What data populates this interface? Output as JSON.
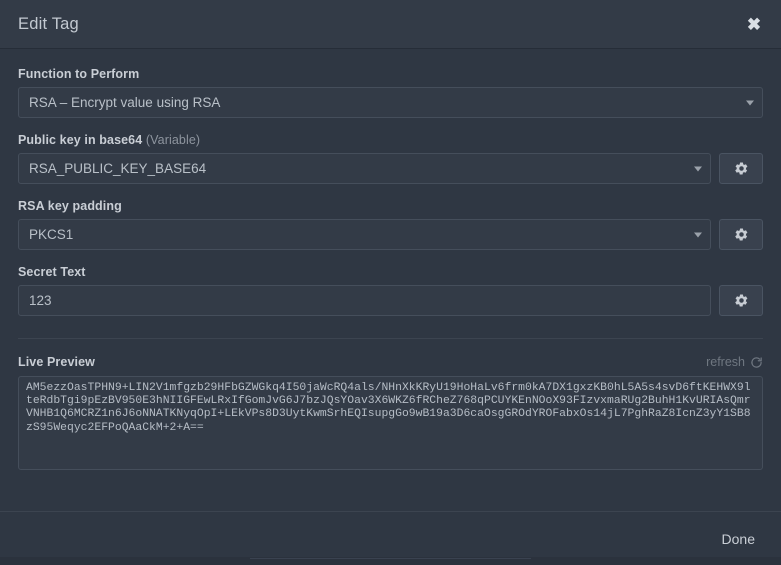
{
  "header": {
    "title": "Edit Tag",
    "close_icon": "close-icon",
    "close_glyph": "✖"
  },
  "form": {
    "function": {
      "label": "Function to Perform",
      "value": "RSA – Encrypt value using RSA",
      "dropdown_icon": "chevron-down-icon"
    },
    "public_key": {
      "label": "Public key in base64",
      "label_suffix": "(Variable)",
      "value": "RSA_PUBLIC_KEY_BASE64",
      "dropdown_icon": "chevron-down-icon",
      "settings_icon": "gear-icon"
    },
    "padding": {
      "label": "RSA key padding",
      "value": "PKCS1",
      "dropdown_icon": "chevron-down-icon",
      "settings_icon": "gear-icon"
    },
    "secret_text": {
      "label": "Secret Text",
      "value": "123",
      "settings_icon": "gear-icon"
    }
  },
  "preview": {
    "label": "Live Preview",
    "refresh_label": "refresh",
    "refresh_icon": "refresh-icon",
    "value": "AM5ezzOasTPHN9+LIN2V1mfgzb29HFbGZWGkq4I50jaWcRQ4als/NHnXkKRyU19HoHaLv6frm0kA7DX1gxzKB0hL5A5s4svD6ftKEHWX9lteRdbTgi9pEzBV950E3hNIIGFEwLRxIfGomJvG6J7bzJQsYOav3X6WKZ6fRCheZ768qPCUYKEnNOoX93FIzvxmaRUg2BuhH1KvURIAsQmrVNHB1Q6MCRZ1n6J6oNNATKNyqOpI+LEkVPs8D3UytKwmSrhEQIsupgGo9wB19a3D6caOsgGROdYROFabxOs14jL7PghRaZ8IcnZ3yY1SB8zS95Weqyc2EFPoQAaCkM+2+A=="
  },
  "footer": {
    "done_label": "Done"
  }
}
